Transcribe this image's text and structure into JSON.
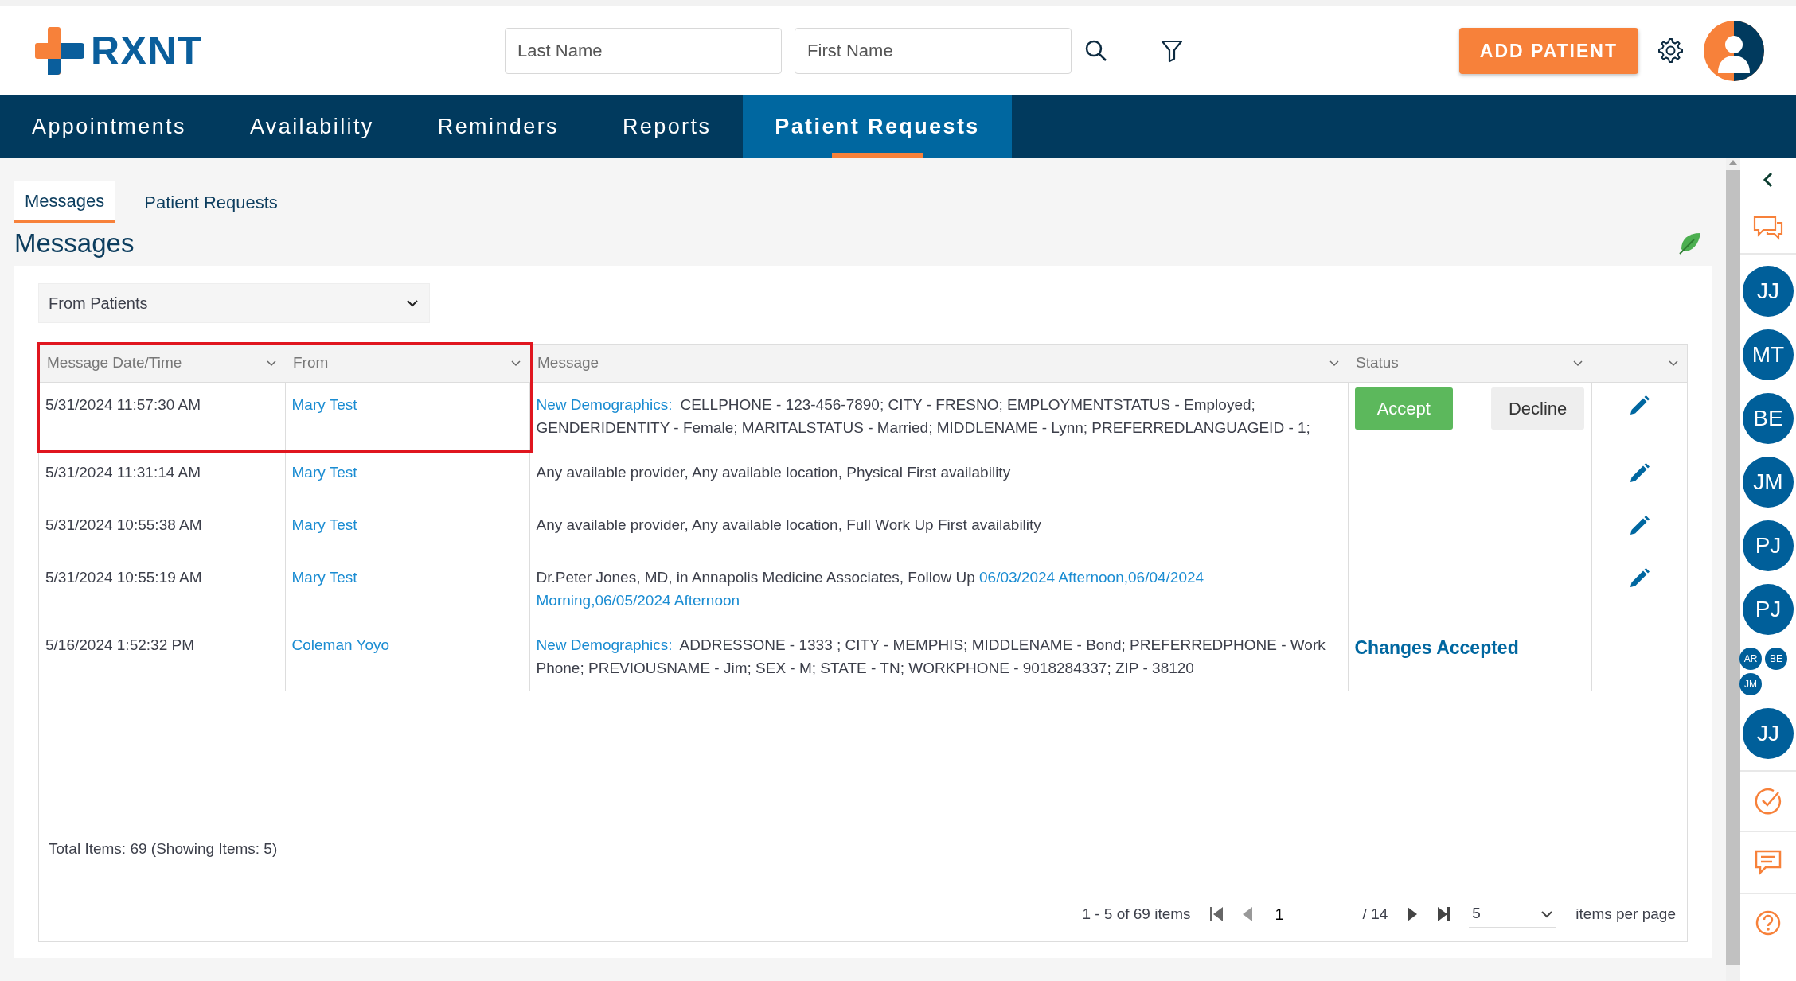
{
  "header": {
    "logo_text": "RXNT",
    "search_fields": [
      {
        "placeholder": "Last Name"
      },
      {
        "placeholder": "First Name"
      }
    ],
    "add_button": "ADD PATIENT"
  },
  "nav": [
    {
      "label": "Appointments",
      "selected": false
    },
    {
      "label": "Availability",
      "selected": false
    },
    {
      "label": "Reminders",
      "selected": false
    },
    {
      "label": "Reports",
      "selected": false
    },
    {
      "label": "Patient Requests",
      "selected": true
    }
  ],
  "subtabs": [
    {
      "label": "Messages",
      "selected": true
    },
    {
      "label": "Patient Requests",
      "selected": false
    }
  ],
  "page_title": "Messages",
  "filter": {
    "value": "From Patients"
  },
  "table": {
    "columns": [
      {
        "label": "Message Date/Time",
        "highlighted": true
      },
      {
        "label": "From",
        "highlighted": true
      },
      {
        "label": "Message",
        "highlighted": false
      },
      {
        "label": "Status",
        "highlighted": false
      },
      {
        "highlighted": false
      }
    ],
    "rows": [
      {
        "date": "5/31/2024 11:57:30 AM",
        "from": "Mary Test",
        "highlighted": true,
        "message": [
          {
            "text": "New Demographics:",
            "link": true
          },
          {
            "text": " CELLPHONE - 123-456-7890; CITY - FRESNO; EMPLOYMENTSTATUS - Employed; GENDERIDENTITY - Female; MARITALSTATUS - Married; MIDDLENAME - Lynn; PREFERREDLANGUAGEID - 1;",
            "link": false
          }
        ],
        "status": {
          "kind": "actions",
          "buttons": [
            "Accept",
            "Decline"
          ]
        },
        "editable": true
      },
      {
        "date": "5/31/2024 11:31:14 AM",
        "from": "Mary Test",
        "highlighted": false,
        "message": [
          {
            "text": "Any available provider, Any available location, Physical First availability",
            "link": false
          }
        ],
        "editable": true
      },
      {
        "date": "5/31/2024 10:55:38 AM",
        "from": "Mary Test",
        "highlighted": false,
        "message": [
          {
            "text": "Any available provider, Any available location, Full Work Up First availability",
            "link": false
          }
        ],
        "editable": true
      },
      {
        "date": "5/31/2024 10:55:19 AM",
        "from": "Mary Test",
        "highlighted": false,
        "message": [
          {
            "text": "Dr.Peter Jones, MD, in Annapolis Medicine Associates, Follow Up ",
            "link": false
          },
          {
            "text": "06/03/2024 Afternoon,06/04/2024",
            "link": true
          },
          {
            "text": "Morning,06/05/2024 Afternoon",
            "link": true
          }
        ],
        "editable": true
      },
      {
        "date": "5/16/2024 1:52:32 PM",
        "from": "Coleman Yoyo",
        "highlighted": false,
        "message": [
          {
            "text": "New Demographics:",
            "link": true
          },
          {
            "text": " ADDRESSONE - 1333 ; CITY - MEMPHIS; MIDDLENAME - Bond; PREFERREDPHONE - Work Phone; PREVIOUSNAME - Jim; SEX - M; STATE - TN; WORKPHONE - 9018284337; ZIP - 38120",
            "link": false
          }
        ],
        "status": {
          "kind": "text",
          "text": "Changes Accepted"
        },
        "editable": false
      }
    ]
  },
  "total_items": "Total Items: 69 (Showing Items: 5)",
  "pager": {
    "range": "1 - 5 of 69 items",
    "page": "1",
    "of_pages": "/ 14",
    "page_size": "5",
    "per_page_label": "items per page"
  },
  "sidebar": {
    "avatars": [
      {
        "kind": "single",
        "initials": "JJ"
      },
      {
        "kind": "single",
        "initials": "MT"
      },
      {
        "kind": "single",
        "initials": "BE"
      },
      {
        "kind": "single",
        "initials": "JM"
      },
      {
        "kind": "single",
        "initials": "PJ"
      },
      {
        "kind": "single",
        "initials": "PJ"
      },
      {
        "kind": "group",
        "members": [
          "AR",
          "BE",
          "JM"
        ]
      },
      {
        "kind": "single",
        "initials": "JJ"
      }
    ]
  }
}
